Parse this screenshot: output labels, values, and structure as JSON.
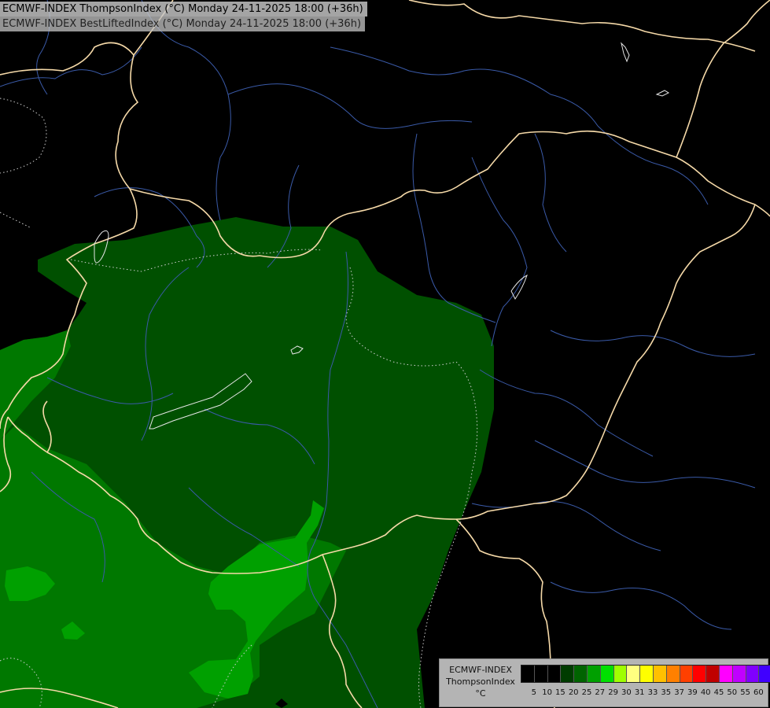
{
  "titles": {
    "line1": "ECMWF-INDEX ThompsonIndex (°C) Monday 24-11-2025 18:00 (+36h)",
    "line2": "ECMWF-INDEX BestLiftedIndex (°C) Monday 24-11-2025 18:00 (+36h)"
  },
  "legend": {
    "model": "ECMWF-INDEX",
    "parameter": "ThompsonIndex",
    "unit": "°C",
    "colors": [
      "#000000",
      "#000000",
      "#000000",
      "#003c00",
      "#006400",
      "#00a000",
      "#00e000",
      "#a0ff00",
      "#ffff80",
      "#ffff00",
      "#ffc000",
      "#ff8000",
      "#ff4000",
      "#ff0000",
      "#c00000",
      "#ff00ff",
      "#c000ff",
      "#8000ff",
      "#4000ff",
      "#0000ff"
    ],
    "ticks": [
      "5",
      "10",
      "15",
      "20",
      "25",
      "27",
      "29",
      "30",
      "31",
      "33",
      "35",
      "37",
      "39",
      "40",
      "45",
      "50",
      "55",
      "60"
    ]
  },
  "map_colors": {
    "background": "#000000",
    "fill_dark": "#005000",
    "fill_mid": "#007800",
    "fill_bright": "#00a000",
    "borders": "#f5d9a8",
    "rivers": "#3a5aa8",
    "contours": "#e6e6e6"
  }
}
